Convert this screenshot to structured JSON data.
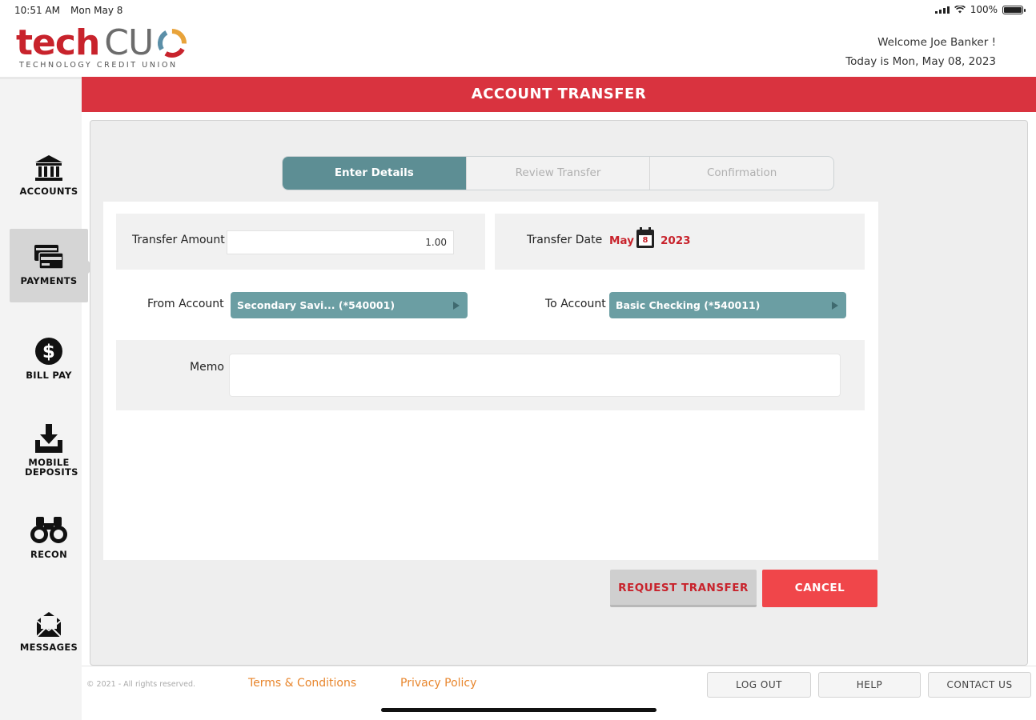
{
  "status_bar": {
    "time": "10:51 AM",
    "date": "Mon May 8",
    "battery": "100%"
  },
  "header": {
    "logo_word_1": "tech",
    "logo_word_2": "CU",
    "logo_subtitle": "TECHNOLOGY CREDIT UNION",
    "welcome": "Welcome  Joe Banker !",
    "today": "Today is Mon, May 08, 2023"
  },
  "title": "ACCOUNT TRANSFER",
  "sidebar": {
    "items": [
      {
        "label": "ACCOUNTS",
        "icon": "bank-icon"
      },
      {
        "label": "PAYMENTS",
        "icon": "payment-card-icon",
        "active": true
      },
      {
        "label": "BILL PAY",
        "icon": "dollar-circle-icon"
      },
      {
        "label": "MOBILE DEPOSITS",
        "icon": "download-tray-icon"
      },
      {
        "label": "RECON",
        "icon": "binoculars-icon"
      },
      {
        "label": "MESSAGES",
        "icon": "envelope-icon"
      }
    ]
  },
  "steps": [
    {
      "label": "Enter Details",
      "active": true
    },
    {
      "label": "Review Transfer",
      "active": false
    },
    {
      "label": "Confirmation",
      "active": false
    }
  ],
  "form": {
    "amount_label": "Transfer Amount",
    "amount_value": "1.00",
    "date_label": "Transfer Date",
    "date_month": "May",
    "date_day": "8",
    "date_year": "2023",
    "from_label": "From Account",
    "from_value": "Secondary Savi...  (*540001)",
    "to_label": "To Account",
    "to_value": "Basic Checking (*540011)",
    "memo_label": "Memo",
    "memo_value": ""
  },
  "actions": {
    "request": "REQUEST TRANSFER",
    "cancel": "CANCEL"
  },
  "footer": {
    "copyright": "© 2021 - All rights reserved.",
    "terms": "Terms & Conditions",
    "privacy": "Privacy Policy",
    "logout": "LOG OUT",
    "help": "HELP",
    "contact": "CONTACT US"
  },
  "colors": {
    "brand_red": "#d9333f",
    "teal": "#5d8e94",
    "select_teal": "#6b9ea3",
    "cancel_red": "#f0464a",
    "link_orange": "#e8862d"
  }
}
